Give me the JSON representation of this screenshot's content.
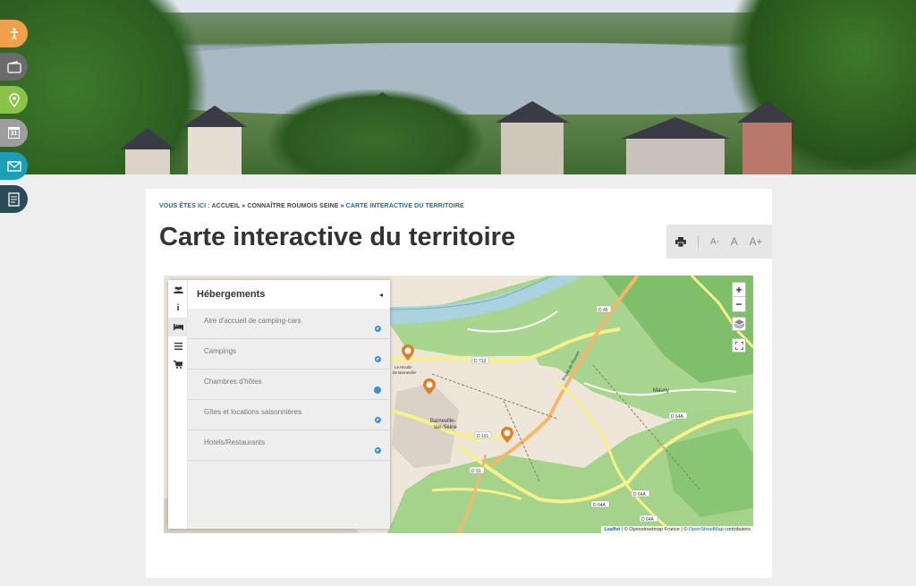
{
  "colors": {
    "accent_blue": "#1a6c9a",
    "side_icon_1": "#f0a04b",
    "side_icon_2": "#6b6b6b",
    "side_icon_3": "#8bc34a",
    "side_icon_4": "#9e9e9e",
    "side_icon_5": "#1a9fb5",
    "side_icon_6": "#2c4a57",
    "pin_orange": "#d9822b",
    "layer_blue": "#3a8fd6"
  },
  "side_icons": [
    {
      "icon": "accessibility-icon"
    },
    {
      "icon": "wallet-icon"
    },
    {
      "icon": "location-pin-icon"
    },
    {
      "icon": "calendar-icon",
      "text": "31"
    },
    {
      "icon": "mail-icon"
    },
    {
      "icon": "brochure-icon"
    }
  ],
  "breadcrumb": {
    "lead": "VOUS ÊTES ICI :",
    "items": [
      "ACCUEIL",
      "CONNAÎTRE ROUMOIS SEINE",
      "CARTE INTERACTIVE DU TERRITOIRE"
    ],
    "separator": "»"
  },
  "page": {
    "title": "Carte interactive du territoire"
  },
  "tools": {
    "decrease": "A-",
    "normal": "A",
    "increase": "A+"
  },
  "map": {
    "panel": {
      "tabs": [
        {
          "icon": "group-icon"
        },
        {
          "icon": "info-icon"
        },
        {
          "icon": "bed-icon",
          "active": true
        },
        {
          "icon": "list-icon"
        },
        {
          "icon": "cart-icon"
        }
      ],
      "title": "Hébergements",
      "collapse": "◂",
      "layers": [
        {
          "label": "Aire d'accueil de camping-cars"
        },
        {
          "label": "Campings"
        },
        {
          "label": "Chambres d'hôtes"
        },
        {
          "label": "Gîtes et locations saisonnières"
        },
        {
          "label": "Hotels/Restaurants"
        }
      ]
    },
    "labels": {
      "town1": "Barneville-",
      "town1b": "sur-Seine",
      "town2": "Mauny",
      "town3": "Le Moulin",
      "town3b": "de Barneville",
      "road1": "D 45",
      "road2": "D 713",
      "road3": "D 101",
      "road4": "D 91",
      "road5": "D 64A",
      "road6": "D 64A",
      "road7": "D 64A",
      "road8": "D 64A",
      "route": "Route de Rouen"
    },
    "controls": {
      "zoom_in": "+",
      "zoom_out": "−"
    },
    "attribution": {
      "leaflet": "Leaflet",
      "sep1": " | © Openstreetmap France | © ",
      "osm": "OpenStreetMap",
      "contributors": " contributors"
    }
  }
}
